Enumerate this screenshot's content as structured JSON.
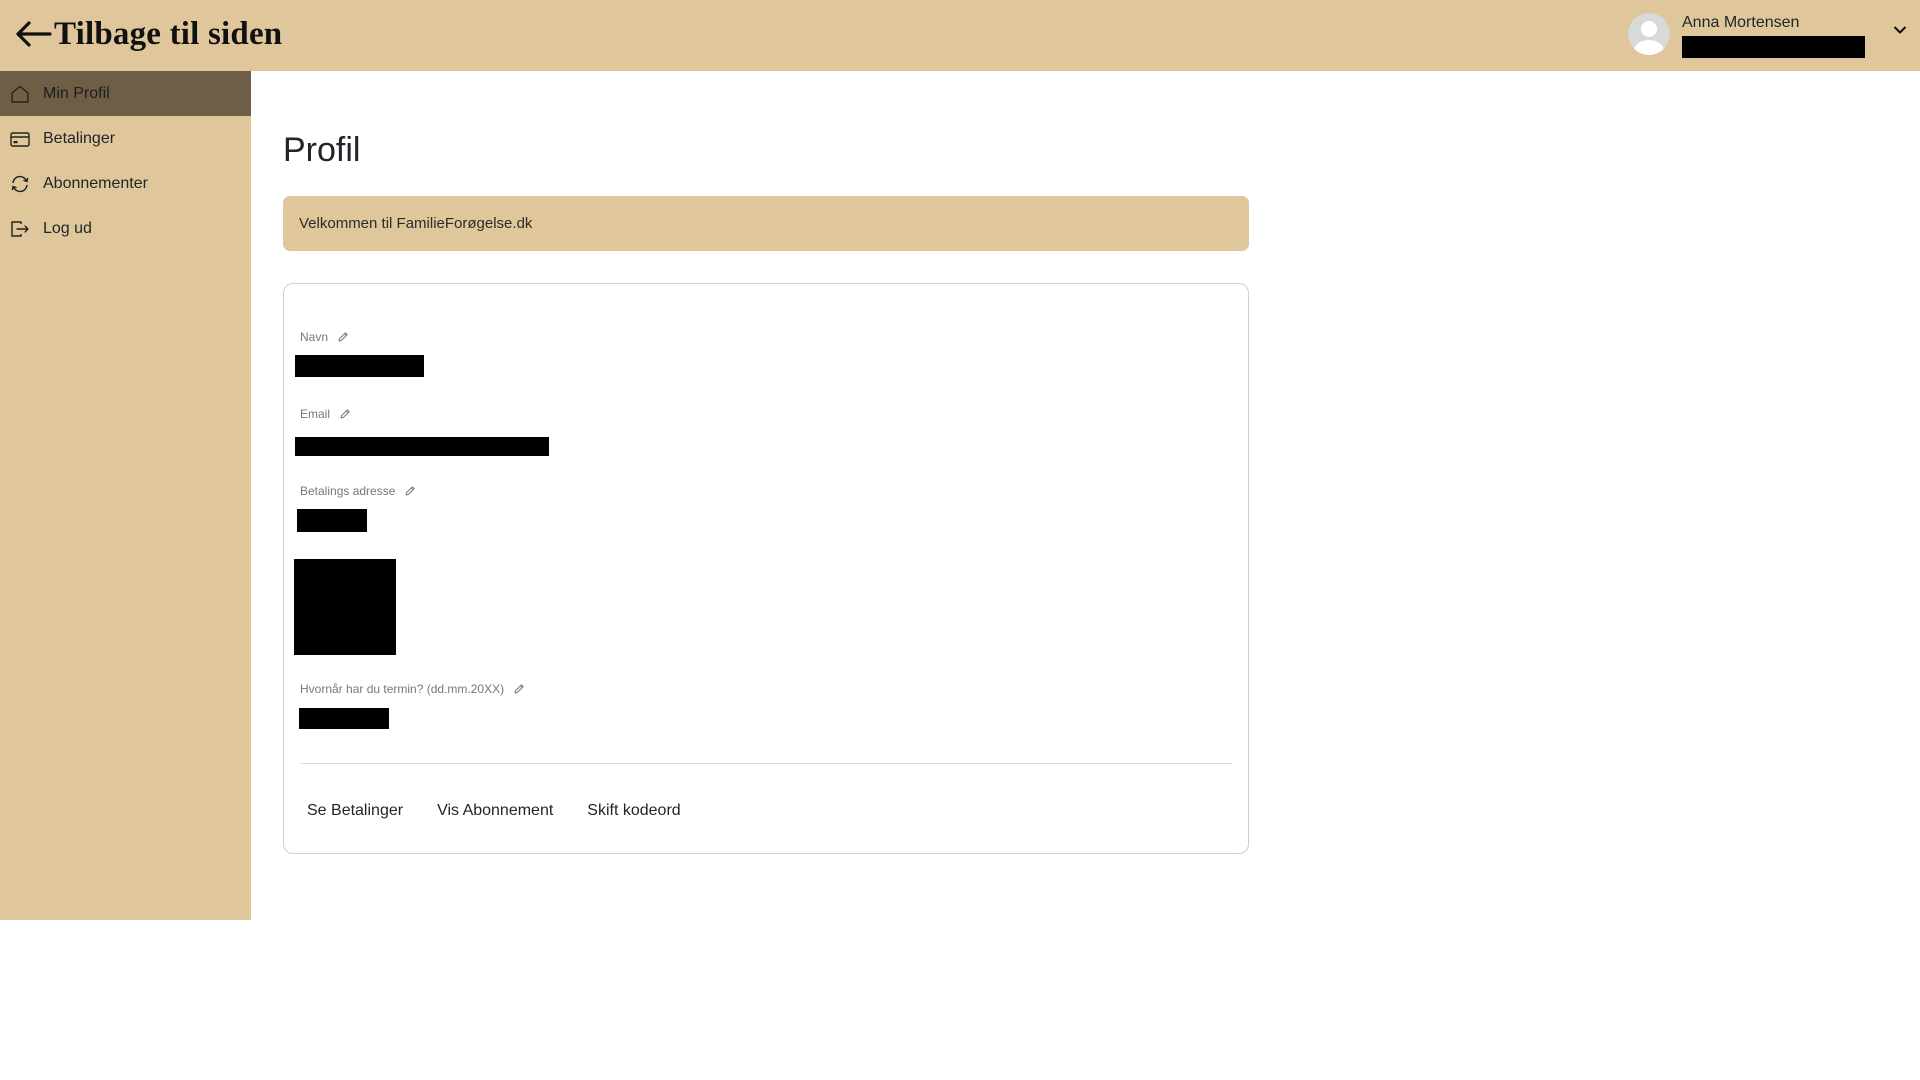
{
  "header": {
    "back_label": "Tilbage til siden",
    "user_name": "Anna Mortensen"
  },
  "sidebar": {
    "items": [
      {
        "label": "Min Profil",
        "icon": "home-icon",
        "active": true
      },
      {
        "label": "Betalinger",
        "icon": "credit-card-icon",
        "active": false
      },
      {
        "label": "Abonnementer",
        "icon": "refresh-icon",
        "active": false
      },
      {
        "label": "Log ud",
        "icon": "logout-icon",
        "active": false
      }
    ]
  },
  "main": {
    "title": "Profil",
    "welcome": "Velkommen til FamilieForøgelse.dk",
    "fields": [
      {
        "label": "Navn"
      },
      {
        "label": "Email"
      },
      {
        "label": "Betalings adresse"
      },
      {
        "label": "Hvornår har du termin? (dd.mm.20XX)"
      }
    ],
    "actions": [
      "Se Betalinger",
      "Vis Abonnement",
      "Skift kodeord"
    ]
  },
  "colors": {
    "brand": "#dfc79b",
    "active_nav": "#6e5e46",
    "redaction": "#000000"
  }
}
